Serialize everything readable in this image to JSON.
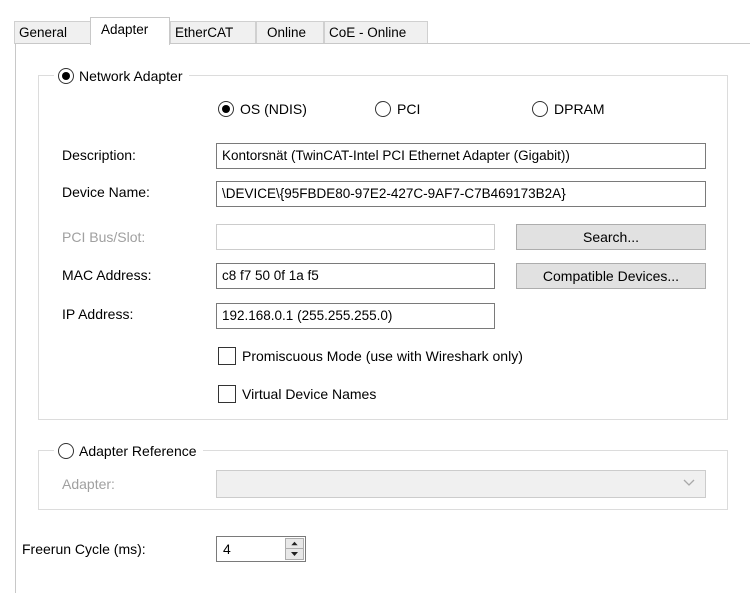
{
  "tabs": [
    {
      "label": "General"
    },
    {
      "label": "Adapter"
    },
    {
      "label": "EtherCAT"
    },
    {
      "label": "Online"
    },
    {
      "label": "CoE - Online"
    }
  ],
  "network_adapter": {
    "label": "Network Adapter",
    "checked": true,
    "modes": [
      {
        "label": "OS (NDIS)",
        "checked": true
      },
      {
        "label": "PCI",
        "checked": false
      },
      {
        "label": "DPRAM",
        "checked": false
      }
    ],
    "fields": {
      "description_label": "Description:",
      "description_value": "Kontorsnät (TwinCAT-Intel PCI Ethernet Adapter (Gigabit))",
      "device_name_label": "Device Name:",
      "device_name_value": "\\DEVICE\\{95FBDE80-97E2-427C-9AF7-C7B469173B2A}",
      "pci_bus_label": "PCI Bus/Slot:",
      "pci_bus_value": "",
      "mac_label": "MAC Address:",
      "mac_value": "c8 f7 50 0f 1a f5",
      "ip_label": "IP Address:",
      "ip_value": "192.168.0.1 (255.255.255.0)"
    },
    "buttons": {
      "search": "Search...",
      "compatible": "Compatible Devices..."
    },
    "checkboxes": [
      {
        "label": "Promiscuous Mode (use with Wireshark only)",
        "checked": false
      },
      {
        "label": "Virtual Device Names",
        "checked": false
      }
    ]
  },
  "adapter_reference": {
    "label": "Adapter Reference",
    "checked": false,
    "adapter_label": "Adapter:",
    "adapter_value": ""
  },
  "freerun": {
    "label": "Freerun Cycle (ms):",
    "value": "4"
  },
  "colors": {
    "tab_bg": "#f0f0f0",
    "border": "#c8c8c8",
    "disabled_text": "#a0a0a0"
  }
}
